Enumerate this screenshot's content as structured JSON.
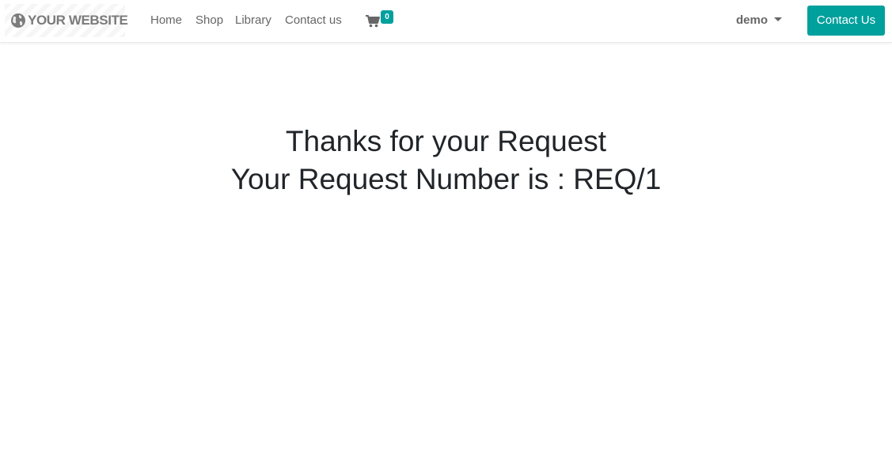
{
  "header": {
    "brand": {
      "icon": "globe-icon",
      "text": "YOUR WEBSITE"
    },
    "nav": [
      {
        "label": "Home"
      },
      {
        "label": "Shop"
      },
      {
        "label": "Library"
      },
      {
        "label": "Contact us"
      }
    ],
    "cart": {
      "icon": "shopping-cart-icon",
      "count": "0"
    },
    "user": {
      "name": "demo",
      "icon": "caret-down-icon"
    },
    "cta_label": "Contact Us"
  },
  "main": {
    "line1": "Thanks for your Request",
    "line2": "Your Request Number is : REQ/1"
  },
  "colors": {
    "accent": "#00a09d",
    "nav_text": "#666666",
    "body_text": "#212529"
  }
}
